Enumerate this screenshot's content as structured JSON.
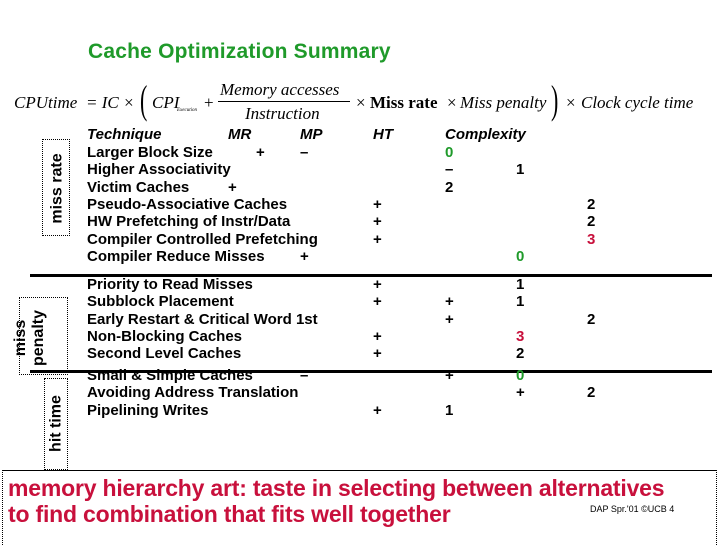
{
  "slide": {
    "title": "Cache Optimization Summary",
    "formula": {
      "lhs": "CPUtime",
      "eq": "= IC ×",
      "cpi": "CPI",
      "cpi_sub": "Execution",
      "plus": "+",
      "numerator": "Memory  accesses",
      "denominator": "Instruction",
      "times1": "×",
      "miss_rate": "Miss rate",
      "times2": "×",
      "miss_penalty": "Miss   penalty",
      "times3": "×",
      "clock": "Clock  cycle  time"
    },
    "table": {
      "headers": {
        "technique": "Technique",
        "mr": "MR",
        "mp": "MP",
        "ht": "HT",
        "complexity": "Complexity"
      },
      "groups": [
        {
          "label": "miss rate",
          "rows": [
            {
              "technique": "Larger Block Size",
              "mr": "+",
              "mp": "–",
              "ht": "",
              "complexity": "0",
              "complexity_color": "green"
            },
            {
              "technique": "Higher Associativity",
              "mr": "+",
              "mp": "",
              "ht": "–",
              "complexity": "1"
            },
            {
              "technique": "Victim Caches",
              "mr": "+",
              "mp": "",
              "ht": "",
              "complexity": "2"
            },
            {
              "technique": "Pseudo-Associative Caches",
              "mr": "+",
              "mp": "",
              "ht": "",
              "complexity": "2"
            },
            {
              "technique": "HW Prefetching of Instr/Data",
              "mr": "+",
              "mp": "",
              "ht": "",
              "complexity": "2"
            },
            {
              "technique": "Compiler Controlled Prefetching",
              "mr": "+",
              "mp": "",
              "ht": "",
              "complexity": "3",
              "complexity_color": "red"
            },
            {
              "technique": "Compiler Reduce Misses",
              "mr": "+",
              "mp": "",
              "ht": "",
              "complexity": "0",
              "complexity_color": "green"
            }
          ]
        },
        {
          "label_line1": "miss",
          "label_line2": "penalty",
          "rows": [
            {
              "technique": "Priority to Read Misses",
              "mr": "",
              "mp": "+",
              "ht": "",
              "complexity": "1"
            },
            {
              "technique": "Subblock Placement",
              "mr": "",
              "mp": "+",
              "ht": "+",
              "complexity": "1"
            },
            {
              "technique": "Early Restart & Critical Word 1st",
              "mr": "",
              "mp": "",
              "ht": "+",
              "complexity": "2"
            },
            {
              "technique": "Non-Blocking Caches",
              "mr": "",
              "mp": "+",
              "ht": "",
              "complexity": "3",
              "complexity_color": "red"
            },
            {
              "technique": "Second Level  Caches",
              "mr": "",
              "mp": "+",
              "ht": "",
              "complexity": "2"
            }
          ]
        },
        {
          "label": "hit time",
          "rows": [
            {
              "technique": "Small & Simple Caches",
              "mr": "–",
              "mp": "",
              "ht": "+",
              "complexity": "0",
              "complexity_color": "green"
            },
            {
              "technique": "Avoiding Address Translation",
              "mr": "",
              "mp": "",
              "ht": "+",
              "complexity": "2"
            },
            {
              "technique": "Pipelining Writes",
              "mr": "",
              "mp": "",
              "ht": "+",
              "complexity": "1"
            }
          ]
        }
      ]
    },
    "conclusion_line1": "memory hierarchy art: taste in selecting between alternatives",
    "conclusion_line2": "to find combination that fits well together",
    "footer": "DAP Spr.'01 ©UCB 4",
    "colors": {
      "title": "#1f9a2a",
      "green_value": "#1f9a2a",
      "red_value": "#c8103c",
      "conclusion": "#c8103c"
    }
  }
}
